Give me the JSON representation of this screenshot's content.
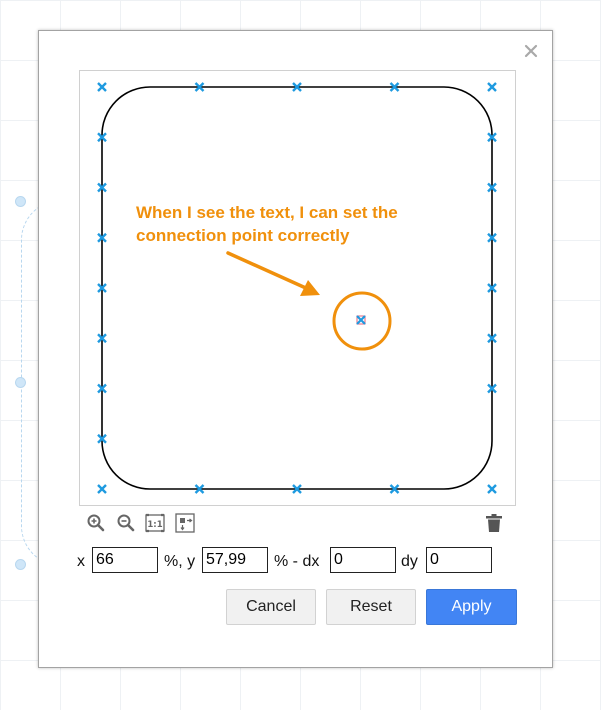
{
  "dialog": {
    "annotation": {
      "line1": "When I see the text, I can set the",
      "line2": "connection point correctly",
      "color": "#f0900c"
    },
    "toolbar": {
      "icons": [
        "zoom-in-icon",
        "zoom-out-icon",
        "actual-size-icon",
        "fit-window-icon",
        "trash-icon"
      ]
    },
    "coords": {
      "x_label": "x",
      "x_value": "66",
      "y_label": "%, y",
      "y_value": "57,99",
      "dx_label": "% - dx",
      "dx_value": "0",
      "dy_label": "dy",
      "dy_value": "0"
    },
    "buttons": {
      "cancel": "Cancel",
      "reset": "Reset",
      "apply": "Apply"
    },
    "colors": {
      "connection_point": "#1e9ae0",
      "primary": "#4285f4"
    }
  }
}
